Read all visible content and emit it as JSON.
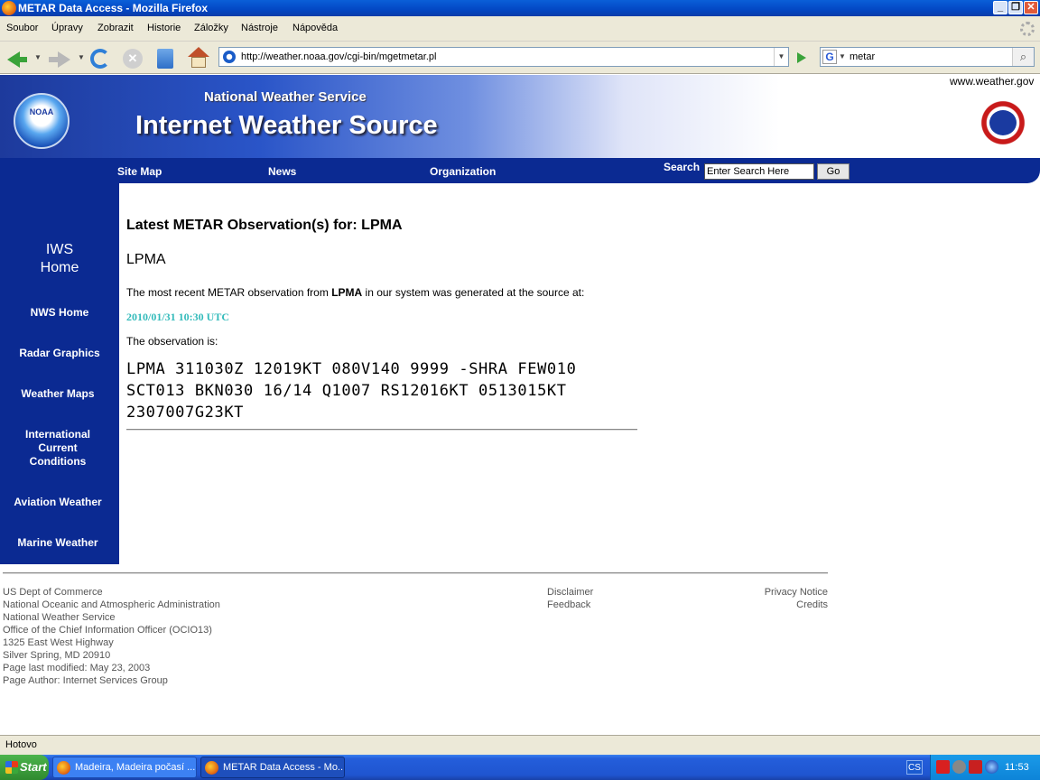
{
  "window": {
    "title": "METAR Data Access - Mozilla Firefox"
  },
  "menu": [
    "Soubor",
    "Úpravy",
    "Zobrazit",
    "Historie",
    "Záložky",
    "Nástroje",
    "Nápověda"
  ],
  "nav": {
    "url": "http://weather.noaa.gov/cgi-bin/mgetmetar.pl",
    "search_value": "metar"
  },
  "header": {
    "noaa_logo": "NOAA",
    "nws": "National Weather Service",
    "title": "Internet Weather Source",
    "www": "www.weather.gov"
  },
  "topnav": {
    "links": [
      "Site Map",
      "News",
      "Organization"
    ],
    "search_label": "Search",
    "search_placeholder": "Enter Search Here",
    "go": "Go"
  },
  "sidebar": {
    "home": [
      "IWS",
      "Home"
    ],
    "items": [
      "NWS Home",
      "Radar Graphics",
      "Weather Maps",
      [
        "International",
        "Current",
        "Conditions"
      ],
      "Aviation Weather",
      "Marine Weather"
    ]
  },
  "main": {
    "heading": "Latest METAR Observation(s) for: LPMA",
    "station": "LPMA",
    "intro_pre": "The most recent METAR observation from ",
    "intro_station": "LPMA",
    "intro_post": " in our system was generated at the source at:",
    "timestamp": "2010/01/31 10:30 UTC",
    "obs_label": "The observation is:",
    "metar_lines": [
      "LPMA 311030Z 12019KT 080V140 9999 -SHRA FEW010",
      "SCT013 BKN030 16/14 Q1007 RS12016KT 0513015KT",
      "2307007G23KT"
    ]
  },
  "footer": {
    "left": [
      "US Dept of Commerce",
      "National Oceanic and Atmospheric Administration",
      "National Weather Service",
      "Office of the Chief Information Officer (OCIO13)",
      "1325 East West Highway",
      "Silver Spring, MD 20910",
      "Page last modified: May 23, 2003",
      "Page Author: Internet Services Group"
    ],
    "mid": [
      "Disclaimer",
      "Feedback"
    ],
    "right": [
      "Privacy Notice",
      "Credits"
    ]
  },
  "status": "Hotovo",
  "taskbar": {
    "start": "Start",
    "tasks": [
      "Madeira, Madeira počasí ...",
      "METAR Data Access - Mo..."
    ],
    "lang": "CS",
    "clock": "11:53"
  }
}
